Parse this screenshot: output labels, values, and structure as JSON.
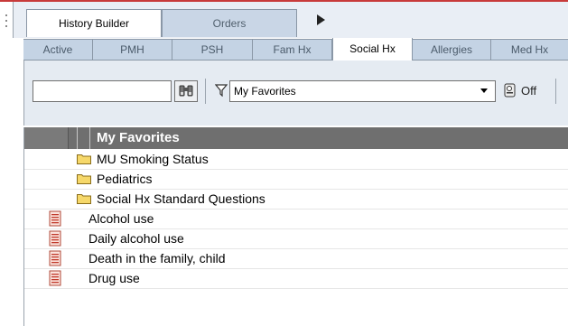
{
  "main_tabs": [
    {
      "label": "History Builder",
      "active": true
    },
    {
      "label": "Orders",
      "active": false
    }
  ],
  "sub_tabs": [
    {
      "label": "Active",
      "active": false
    },
    {
      "label": "PMH",
      "active": false
    },
    {
      "label": "PSH",
      "active": false
    },
    {
      "label": "Fam Hx",
      "active": false
    },
    {
      "label": "Social Hx",
      "active": true
    },
    {
      "label": "Allergies",
      "active": false
    },
    {
      "label": "Med Hx",
      "active": false
    }
  ],
  "toolbar": {
    "search_value": "",
    "favorites_select": "My Favorites",
    "off_label": "Off"
  },
  "list": {
    "header": "My Favorites",
    "items": [
      {
        "type": "folder",
        "label": "MU Smoking Status"
      },
      {
        "type": "folder",
        "label": "Pediatrics"
      },
      {
        "type": "folder",
        "label": "Social Hx Standard Questions"
      },
      {
        "type": "form",
        "label": "Alcohol use"
      },
      {
        "type": "form",
        "label": "Daily alcohol use"
      },
      {
        "type": "form",
        "label": "Death in the family, child"
      },
      {
        "type": "form",
        "label": "Drug use"
      }
    ]
  },
  "colors": {
    "tab_bar": "#c4d3e4",
    "header_bg": "#6f6f6f",
    "folder": "#f6d86a"
  }
}
